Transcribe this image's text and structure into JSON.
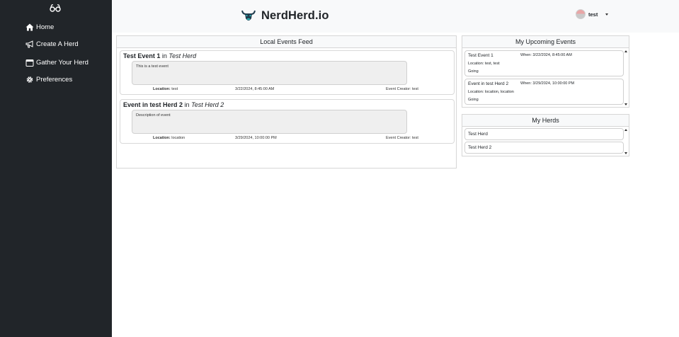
{
  "sidebar": {
    "logo_icon": "glasses-icon",
    "items": [
      {
        "label": "Home",
        "icon": "home-icon"
      },
      {
        "label": "Create A Herd",
        "icon": "megaphone-icon"
      },
      {
        "label": "Gather Your Herd",
        "icon": "calendar-icon"
      },
      {
        "label": "Preferences",
        "icon": "gear-icon"
      }
    ]
  },
  "header": {
    "brand": "NerdHerd.io",
    "brand_icon": "bull-head-icon",
    "user": "test"
  },
  "feed": {
    "title": "Local Events Feed",
    "events": [
      {
        "name": "Test Event 1",
        "in": "in",
        "herd": "Test Herd",
        "description": "This is a test event",
        "location_label": "Location:",
        "location": "test",
        "datetime": "3/22/2024, 8:45:00 AM",
        "creator_label": "Event Creator:",
        "creator": "test"
      },
      {
        "name": "Event in test Herd 2",
        "in": "in",
        "herd": "Test Herd 2",
        "description": "Description of event",
        "location_label": "Location:",
        "location": "location",
        "datetime": "3/29/2024, 10:00:00 PM",
        "creator_label": "Event Creator:",
        "creator": "test"
      }
    ]
  },
  "upcoming": {
    "title": "My Upcoming Events",
    "items": [
      {
        "name": "Test Event 1",
        "when": "When: 3/22/2024, 8:45:00 AM",
        "location": "Location: test, test",
        "status": "Going"
      },
      {
        "name": "Event in test Herd 2",
        "when": "When: 3/29/2024, 10:00:00 PM",
        "location": "Location: location, location",
        "status": "Going"
      }
    ]
  },
  "herds": {
    "title": "My Herds",
    "items": [
      "Test Herd",
      "Test Herd 2"
    ]
  }
}
